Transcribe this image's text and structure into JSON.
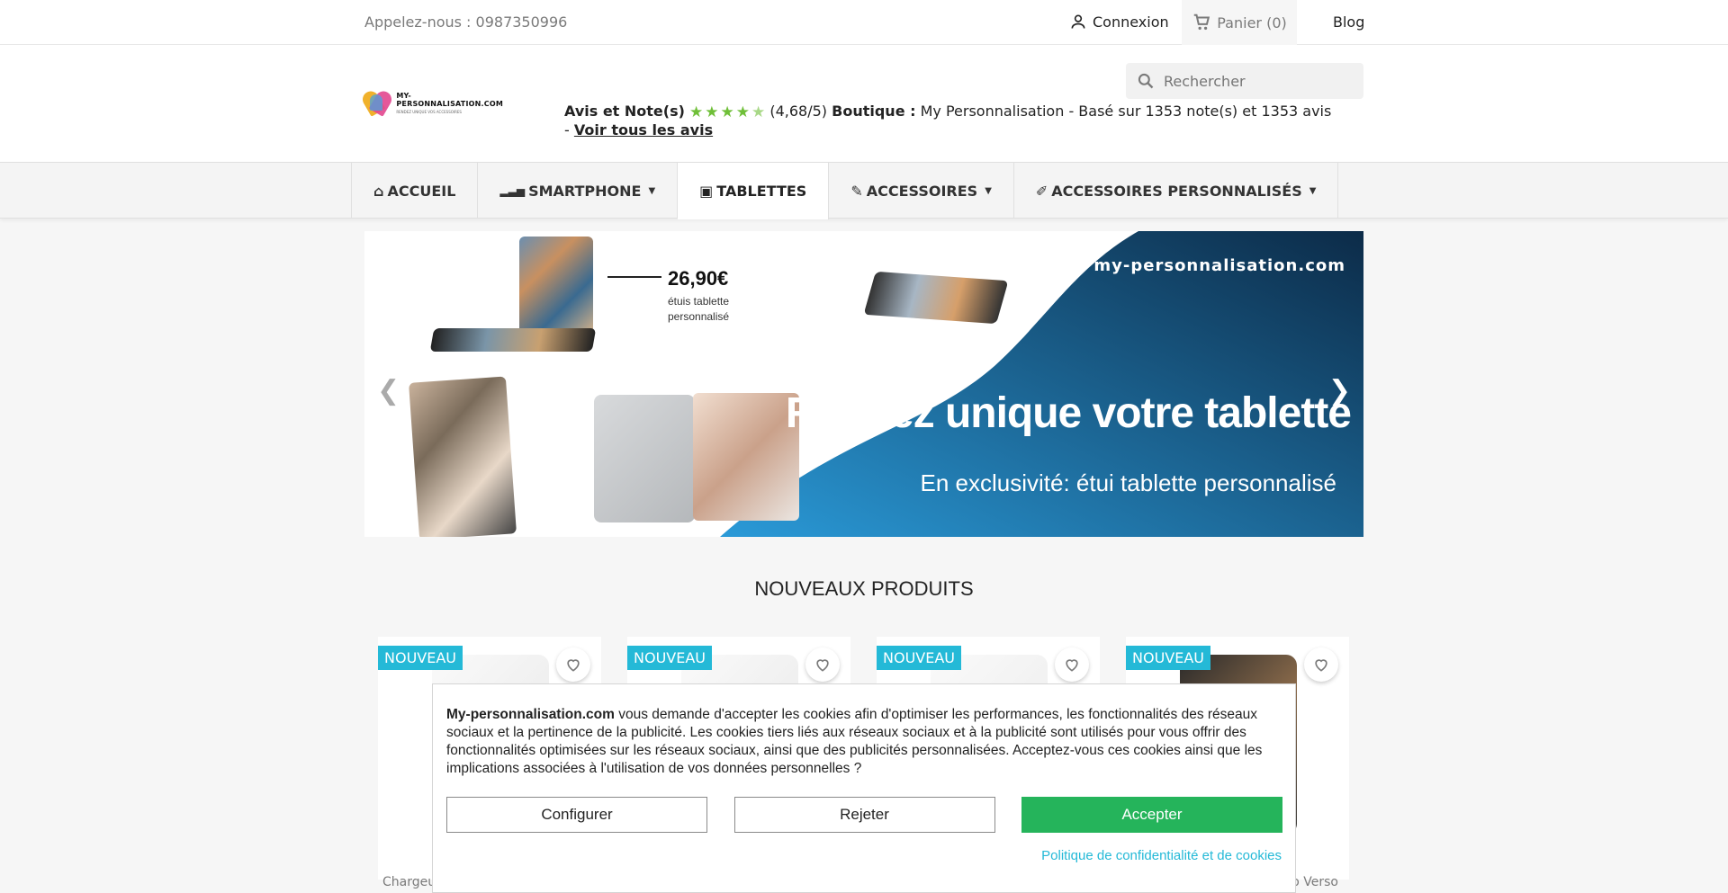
{
  "topbar": {
    "phone": "Appelez-nous : 0987350996",
    "login": "Connexion",
    "cart": "Panier (0)",
    "blog": "Blog"
  },
  "header": {
    "logo_brand": "MY-PERSONNALISATION.COM",
    "logo_tagline": "RENDEZ UNIQUE VOS ACCESSOIRES",
    "search_placeholder": "Rechercher",
    "reviews": {
      "label": "Avis et Note(s)",
      "rating": "(4,68/5)",
      "shop_label": "Boutique :",
      "shop_text": "My Personnalisation - Basé sur 1353 note(s) et 1353 avis",
      "dash": "-",
      "link": "Voir tous les avis",
      "stars_value": 4.68
    }
  },
  "nav": {
    "items": [
      {
        "label": "ACCUEIL",
        "icon": "home-icon"
      },
      {
        "label": "SMARTPHONE",
        "icon": "signal-icon"
      },
      {
        "label": "TABLETTES",
        "icon": "image-icon"
      },
      {
        "label": "ACCESSOIRES",
        "icon": "rocket-icon"
      },
      {
        "label": "ACCESSOIRES PERSONNALISÉS",
        "icon": "brush-icon"
      }
    ]
  },
  "banner": {
    "site": "my-personnalisation.com",
    "price": "26,90€",
    "price_desc": "étuis tablette personnalisé",
    "headline": "Rendez unique votre tablette",
    "subline": "En exclusivité: étui tablette personnalisé",
    "colors": {
      "blue_light": "#2a9ad8",
      "blue_dark": "#0c2b48"
    }
  },
  "section": {
    "title": "NOUVEAUX PRODUITS"
  },
  "products": [
    {
      "badge": "NOUVEAU",
      "name": "Chargeu"
    },
    {
      "badge": "NOUVEAU",
      "name": ""
    },
    {
      "badge": "NOUVEAU",
      "name": ""
    },
    {
      "badge": "NOUVEAU",
      "name": "o Verso"
    }
  ],
  "cookie": {
    "site": "My-personnalisation.com",
    "message": " vous demande d'accepter les cookies afin d'optimiser les performances, les fonctionnalités des réseaux sociaux et la pertinence de la publicité. Les cookies tiers liés aux réseaux sociaux et à la publicité sont utilisés pour vous offrir des fonctionnalités optimisées sur les réseaux sociaux, ainsi que des publicités personnalisées. Acceptez-vous ces cookies ainsi que les implications associées à l'utilisation de vos données personnelles ?",
    "configure": "Configurer",
    "reject": "Rejeter",
    "accept": "Accepter",
    "policy": "Politique de confidentialité et de cookies"
  }
}
